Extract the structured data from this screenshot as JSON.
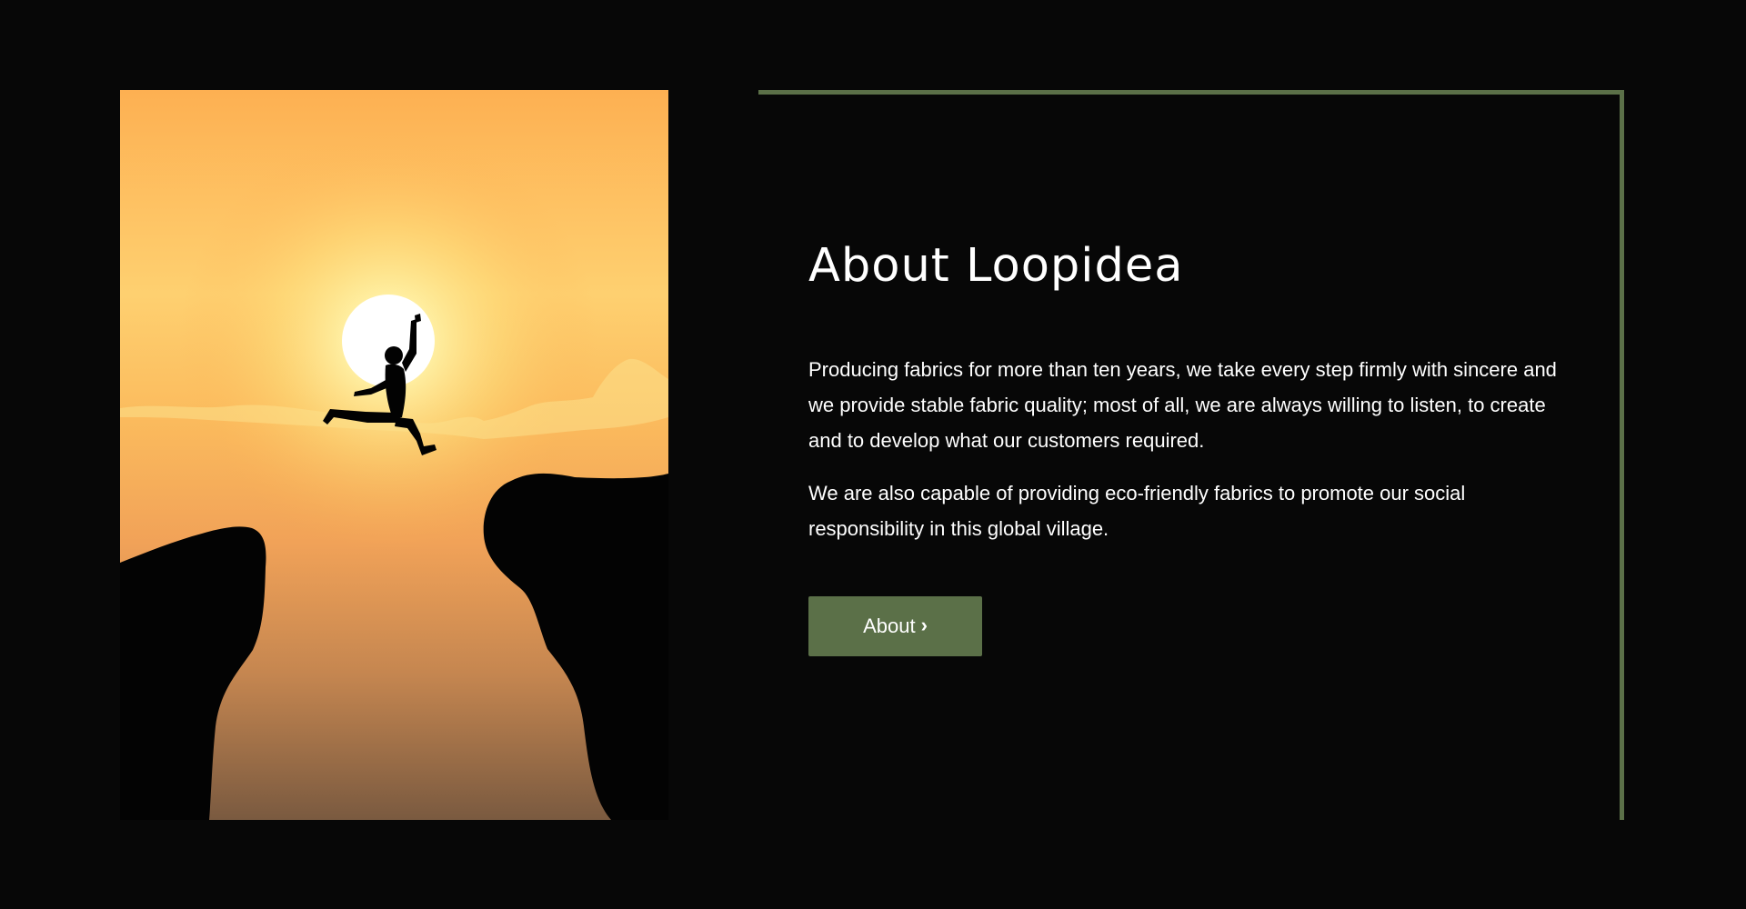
{
  "about": {
    "heading": "About Loopidea",
    "paragraph_1": "Producing fabrics for more than ten years, we take every step firmly with sincere and we provide stable fabric quality; most of all, we are always willing to listen, to create and to develop what our customers required.",
    "paragraph_2": "We are also capable of providing eco-friendly fabrics to promote our social responsibility in this global village.",
    "button_label": "About",
    "button_icon": "chevron-right-icon"
  },
  "colors": {
    "page_background": "#070707",
    "accent": "#5b7048",
    "text": "#ffffff",
    "sky_top": "#fdb052",
    "sky_glow": "#fde07e",
    "sky_bottom": "#7a5a40"
  }
}
